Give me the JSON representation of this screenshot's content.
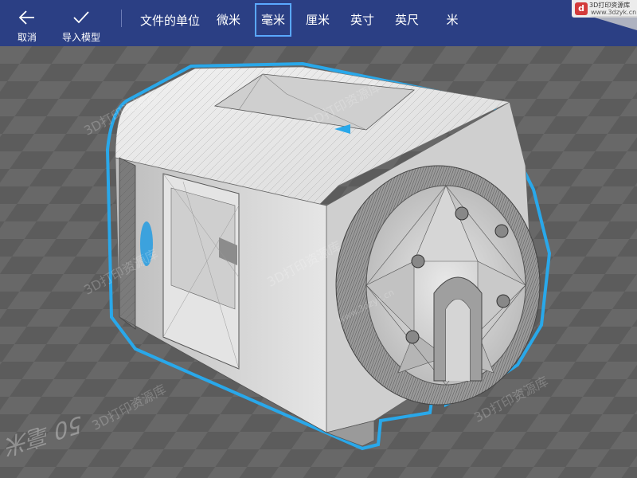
{
  "toolbar": {
    "cancel_label": "取消",
    "import_label": "导入模型",
    "units_title": "文件的单位",
    "units": [
      "微米",
      "毫米",
      "厘米",
      "英寸",
      "英尺",
      "米"
    ],
    "selected_unit": "毫米"
  },
  "icons": {
    "cancel": "back-arrow-icon",
    "import": "checkmark-icon"
  },
  "viewport": {
    "scale_label": "50 毫米",
    "watermarks": [
      "3D打印资源库",
      "3D打印资源库",
      "3D打印资源库",
      "3D打印资源库",
      "3D打印资源库",
      "3D打印资源库"
    ],
    "watermark_sub": "www.3dzyk.cn"
  },
  "badge": {
    "line1": "3D打印资源库",
    "line2": "www.3dzyk.cn"
  },
  "colors": {
    "toolbar_bg": "#2b3f84",
    "selection_outline": "#29a8ea",
    "selected_unit_border": "#5aa8ff",
    "floor_dark": "#5e5e5e",
    "floor_light": "#6a6a6a"
  }
}
